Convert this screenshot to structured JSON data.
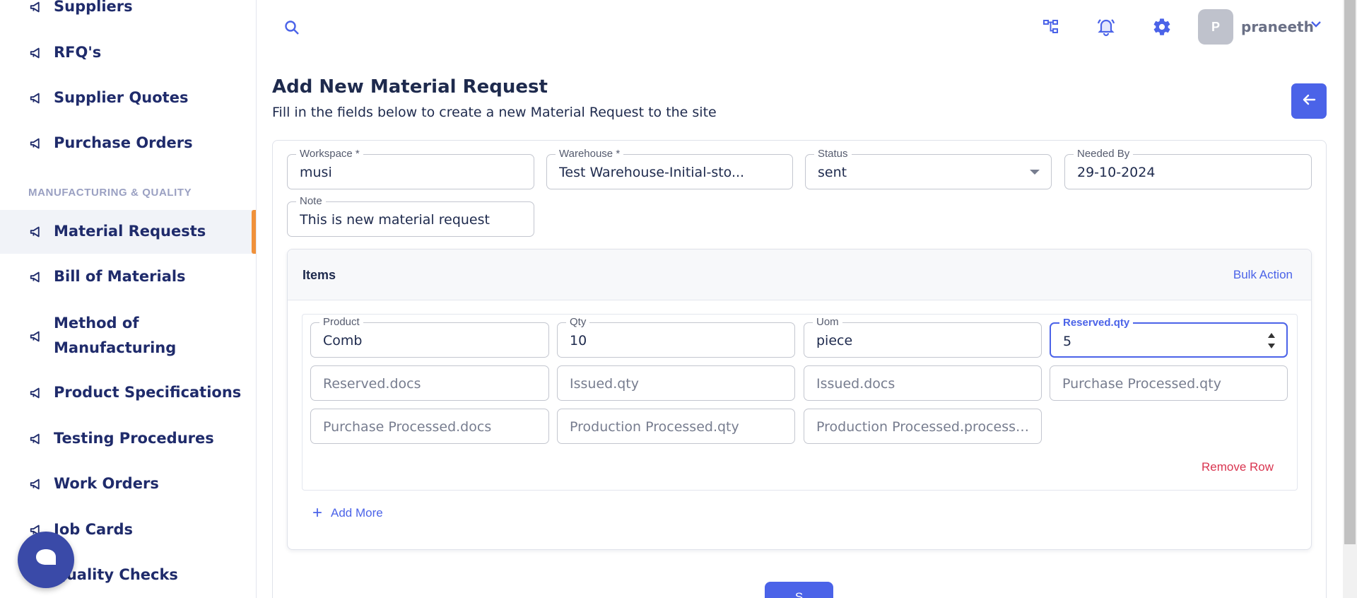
{
  "sidebar": {
    "items": [
      {
        "label": "Suppliers"
      },
      {
        "label": "RFQ's"
      },
      {
        "label": "Supplier Quotes"
      },
      {
        "label": "Purchase Orders"
      },
      {
        "label": "Material Requests"
      },
      {
        "label": "Bill of Materials"
      },
      {
        "label": "Method of Manufacturing"
      },
      {
        "label": "Product Specifications"
      },
      {
        "label": "Testing Procedures"
      },
      {
        "label": "Work Orders"
      },
      {
        "label": "Job Cards"
      },
      {
        "label": "Quality Checks"
      }
    ],
    "section_label": "MANUFACTURING & QUALITY",
    "active_item": "Material Requests"
  },
  "topbar": {
    "avatar_initial": "P",
    "username": "praneeth"
  },
  "page": {
    "title": "Add New Material Request",
    "subtitle": "Fill in the fields below to create a new Material Request to the site"
  },
  "form": {
    "workspace": {
      "label": "Workspace *",
      "value": "musi"
    },
    "warehouse": {
      "label": "Warehouse *",
      "value": "Test Warehouse-Initial-sto..."
    },
    "status": {
      "label": "Status",
      "value": "sent"
    },
    "needed_by": {
      "label": "Needed By",
      "value": "29-10-2024"
    },
    "note": {
      "label": "Note",
      "value": "This is new material request"
    }
  },
  "items": {
    "title": "Items",
    "bulk_action": "Bulk Action",
    "rows": [
      {
        "product": {
          "label": "Product",
          "value": "Comb"
        },
        "qty": {
          "label": "Qty",
          "value": "10"
        },
        "uom": {
          "label": "Uom",
          "value": "piece"
        },
        "reserved_qty": {
          "label": "Reserved.qty",
          "value": "5"
        },
        "reserved_docs": {
          "placeholder": "Reserved.docs"
        },
        "issued_qty": {
          "placeholder": "Issued.qty"
        },
        "issued_docs": {
          "placeholder": "Issued.docs"
        },
        "purchase_processed_qty": {
          "placeholder": "Purchase Processed.qty"
        },
        "purchase_processed_docs": {
          "placeholder": "Purchase Processed.docs"
        },
        "production_processed_qty": {
          "placeholder": "Production Processed.qty"
        },
        "production_processed_process": {
          "placeholder": "Production Processed.process D..."
        }
      }
    ],
    "remove_row": "Remove Row",
    "add_more": "Add More"
  },
  "save_button": "S",
  "colors": {
    "accent": "#4b63e8",
    "active_marker": "#f0913a",
    "danger": "#d93550",
    "nav_text": "#1f2b6b"
  },
  "icons": {
    "nav": "megaphone-icon",
    "search": "search-icon",
    "hierarchy": "hierarchy-icon",
    "notifications": "bell-icon",
    "settings": "gear-icon",
    "user_menu": "chevron-down-icon",
    "back": "arrow-left-icon",
    "chat": "chat-icon"
  }
}
